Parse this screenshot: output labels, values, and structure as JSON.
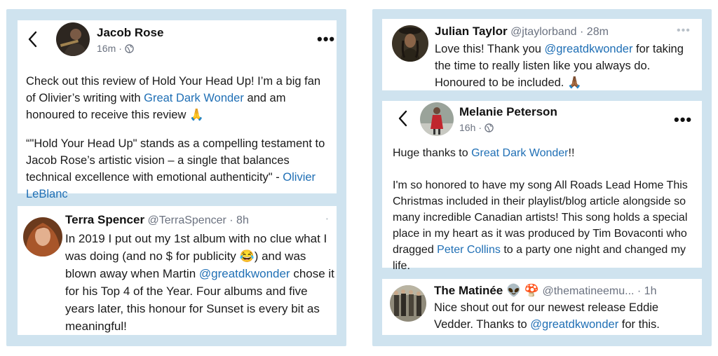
{
  "posts": {
    "jacob": {
      "name": "Jacob Rose",
      "time": "16m",
      "text_a": "Check out this review of Hold Your Head Up! I’m a big fan of Olivier’s writing with ",
      "link_a": "Great Dark Wonder",
      "text_b": " and am honoured to receive this review 🙏",
      "quote": "“\"Hold Your Head Up\" stands as a compelling testament to Jacob Rose’s artistic vision – a single that balances technical excellence with emotional authenticity\" - ",
      "link_b": "Olivier LeBlanc"
    },
    "terra": {
      "name": "Terra Spencer",
      "handle": "@TerraSpencer",
      "time": "8h",
      "text_a": "In 2019 I put out my 1st album with no clue what I was doing (and no $ for publicity 😂) and was blown away when Martin ",
      "mention": "@greatdkwonder",
      "text_b": " chose it for his Top 4 of the Year. Four albums and five years later, this honour  for Sunset is every bit as meaningful!"
    },
    "julian": {
      "name": "Julian Taylor",
      "handle": "@jtaylorband",
      "time": "28m",
      "text_a": "Love this! Thank you ",
      "mention": "@greatdkwonder",
      "text_b": " for taking the time to really listen like you always do. Honoured to be included. 🙏🏾"
    },
    "melanie": {
      "name": "Melanie Peterson",
      "time": "16h",
      "text_a": "Huge thanks to ",
      "link_a": "Great Dark Wonder",
      "text_b": "!!",
      "text_c": "I'm so honored to have my song All Roads Lead Home This Christmas included in their playlist/blog article alongside so many incredible Canadian artists! This song holds a special place in my heart as it was produced by Tim Bovaconti who dragged ",
      "link_b": "Peter Collins",
      "text_d": " to a party one night and changed my life."
    },
    "matinee": {
      "name": "The Matinée 👽 🍄",
      "handle": "@thematineemu...",
      "time": "1h",
      "text_a": "Nice shout out for our newest release Eddie Vedder. Thanks to ",
      "mention": "@greatdkwonder",
      "text_b": " for this."
    }
  },
  "icons": {
    "back": "chevron-left-icon",
    "globe": "globe-icon",
    "more": "more-icon"
  },
  "colors": {
    "panel": "#cfe3ef",
    "link": "#1f6fb5",
    "meta": "#6b7280"
  }
}
